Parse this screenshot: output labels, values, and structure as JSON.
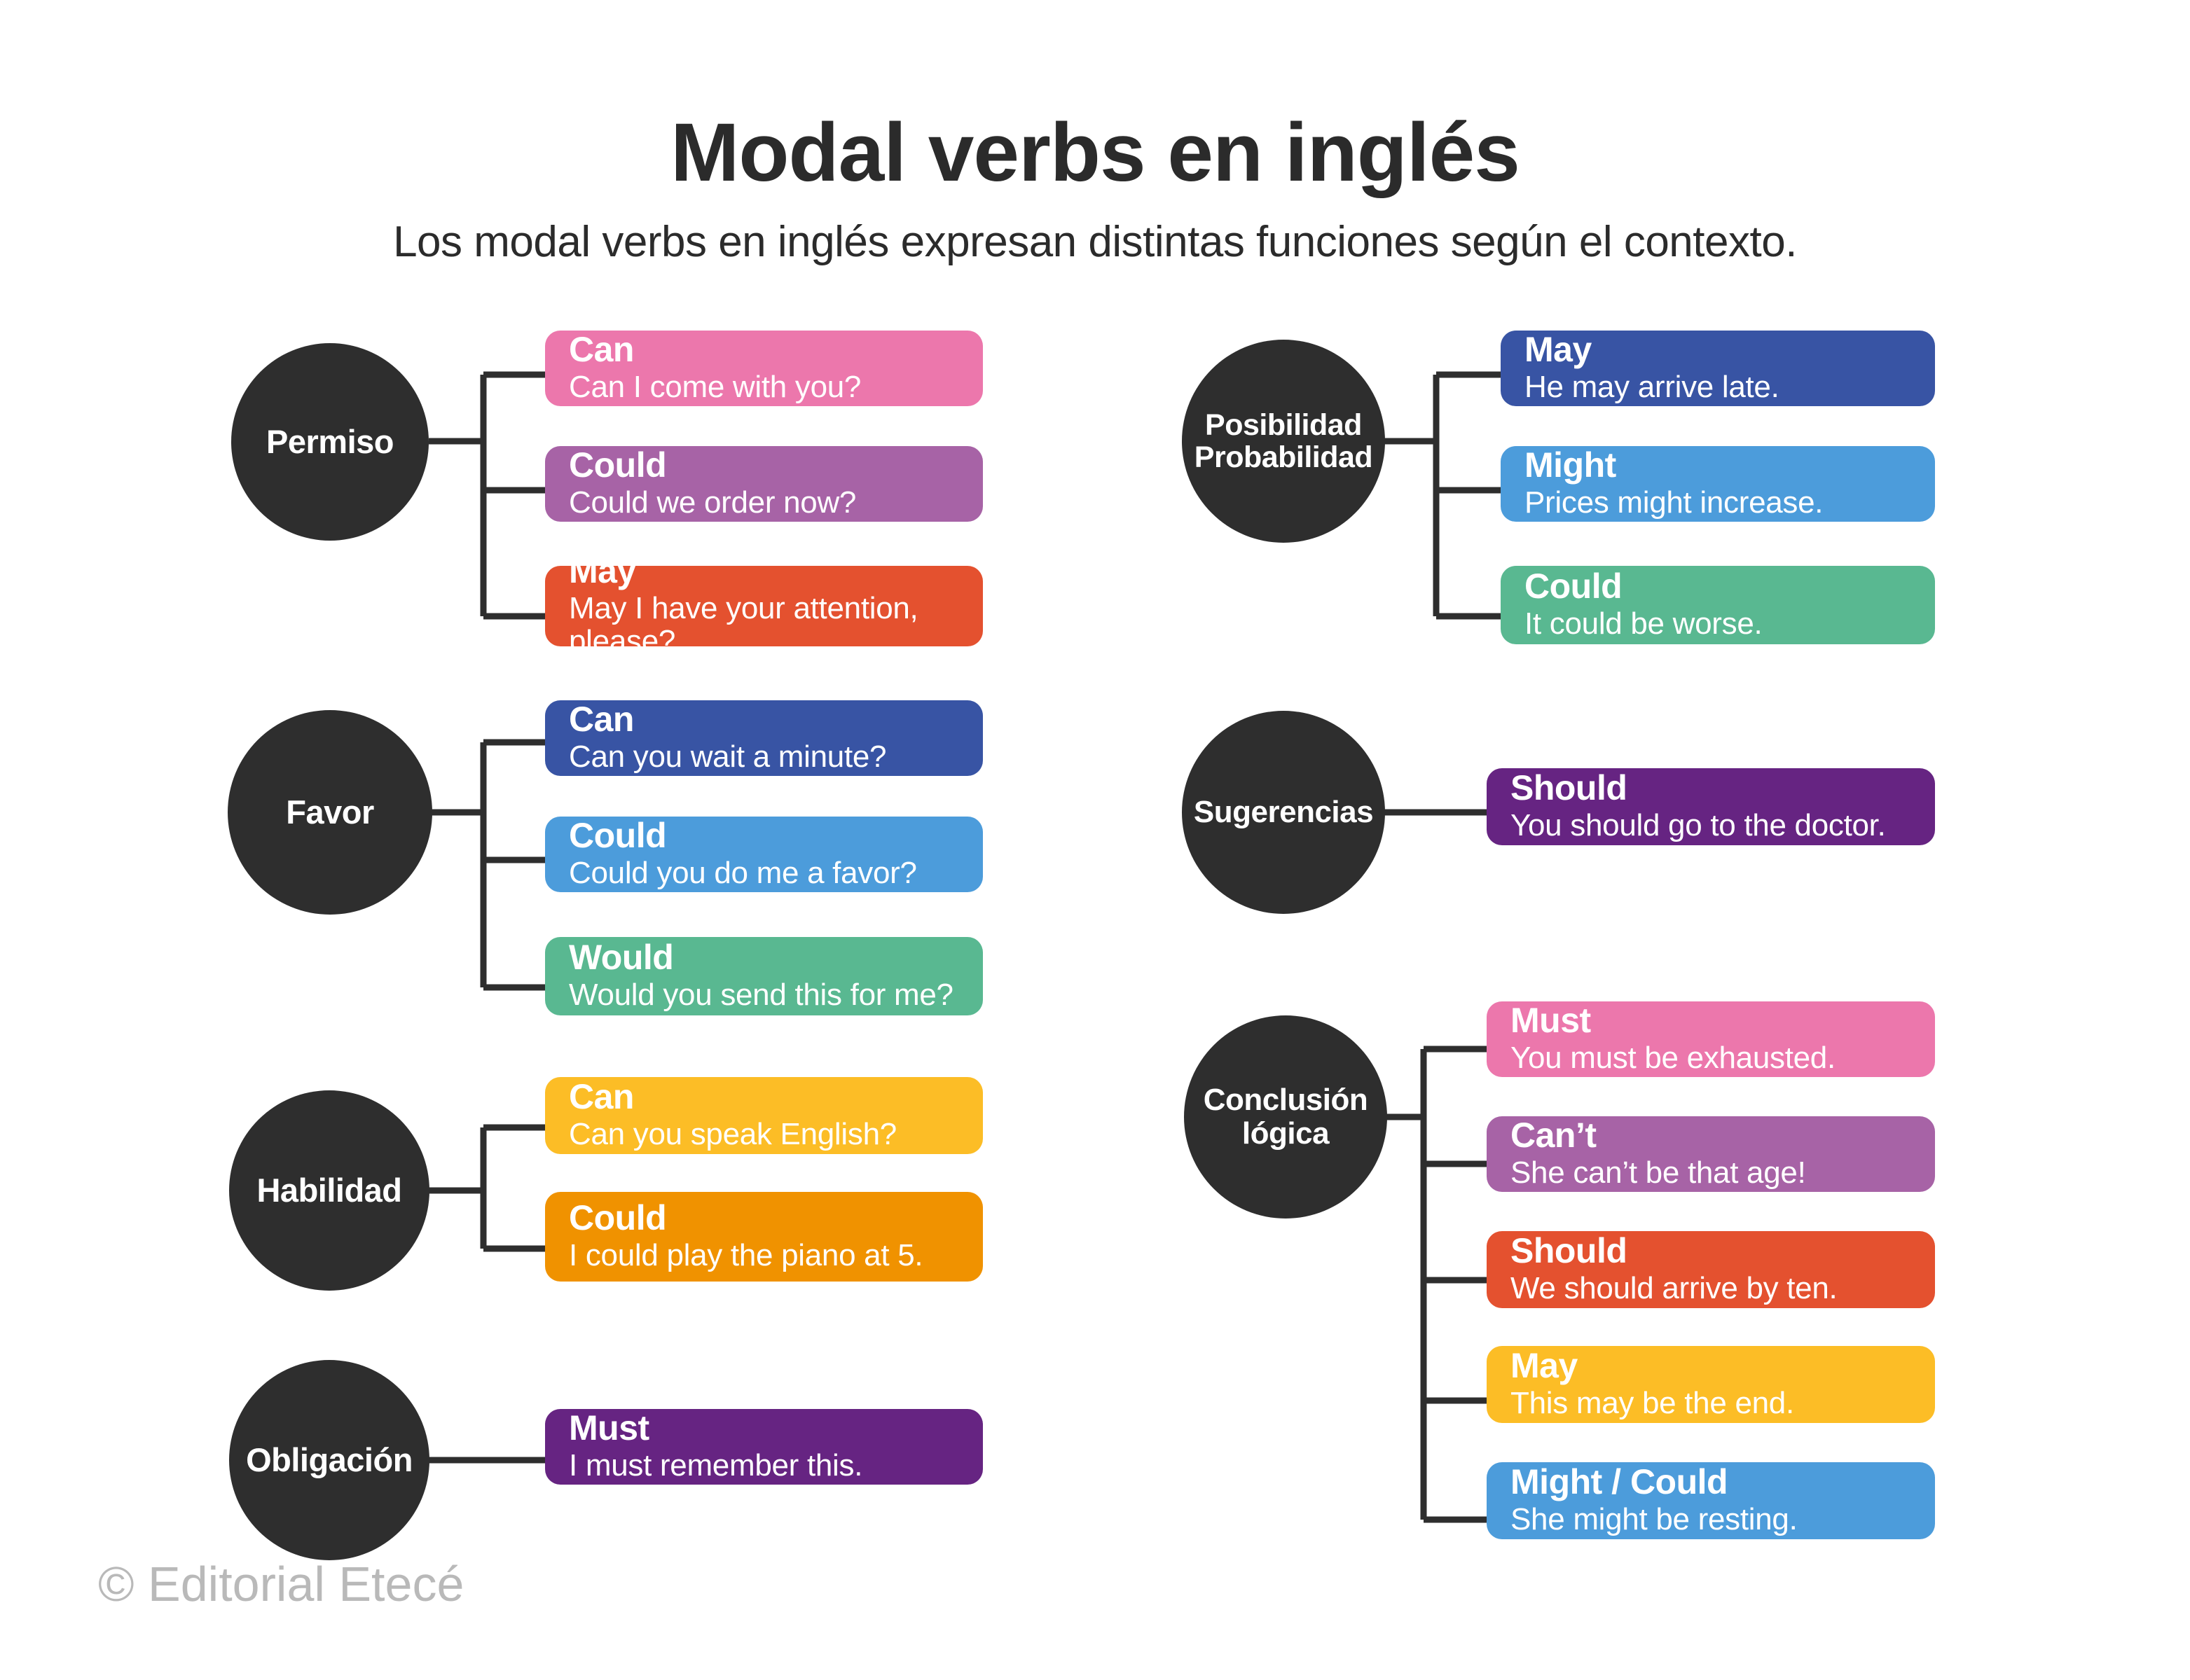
{
  "header": {
    "title": "Modal verbs en inglés",
    "subtitle": "Los modal verbs en inglés expresan distintas funciones según el contexto."
  },
  "watermark": "© Editorial Etecé",
  "colors": {
    "bubble": "#2e2e2e",
    "connector": "#2e2e2e",
    "text_dark": "#2b2b2b",
    "pink": "#ec77ac",
    "mauve": "#a763a6",
    "red": "#e4512f",
    "dark_blue": "#3854a4",
    "light_blue": "#4c9cdb",
    "green": "#59b891",
    "yellow": "#fcbd26",
    "orange": "#f09200",
    "purple": "#662482",
    "watermark": "#b9b9b9"
  },
  "groups": [
    {
      "id": "permiso",
      "label": "Permiso",
      "items": [
        {
          "modal": "Can",
          "example": "Can I come with you?",
          "color": "#ec77ac"
        },
        {
          "modal": "Could",
          "example": "Could we order now?",
          "color": "#a763a6"
        },
        {
          "modal": "May",
          "example": "May I have your attention, please?",
          "color": "#e4512f"
        }
      ]
    },
    {
      "id": "favor",
      "label": "Favor",
      "items": [
        {
          "modal": "Can",
          "example": "Can you wait a minute?",
          "color": "#3854a4"
        },
        {
          "modal": "Could",
          "example": "Could you do me a favor?",
          "color": "#4c9cdb"
        },
        {
          "modal": "Would",
          "example": "Would you send this for me?",
          "color": "#59b891"
        }
      ]
    },
    {
      "id": "habilidad",
      "label": "Habilidad",
      "items": [
        {
          "modal": "Can",
          "example": "Can you speak English?",
          "color": "#fcbd26"
        },
        {
          "modal": "Could",
          "example": "I could play the piano at 5.",
          "color": "#f09200"
        }
      ]
    },
    {
      "id": "obligacion",
      "label": "Obligación",
      "items": [
        {
          "modal": "Must",
          "example": "I must remember this.",
          "color": "#662482"
        }
      ]
    },
    {
      "id": "posibilidad",
      "label": "Posibilidad\nProbabilidad",
      "items": [
        {
          "modal": "May",
          "example": "He may arrive late.",
          "color": "#3854a4"
        },
        {
          "modal": "Might",
          "example": "Prices might increase.",
          "color": "#4c9cdb"
        },
        {
          "modal": "Could",
          "example": "It could be worse.",
          "color": "#59b891"
        }
      ]
    },
    {
      "id": "sugerencias",
      "label": "Sugerencias",
      "items": [
        {
          "modal": "Should",
          "example": "You should go to the doctor.",
          "color": "#662482"
        }
      ]
    },
    {
      "id": "conclusion",
      "label": "Conclusión\nlógica",
      "items": [
        {
          "modal": "Must",
          "example": "You must be exhausted.",
          "color": "#ec77ac"
        },
        {
          "modal": "Can’t",
          "example": "She can’t be that age!",
          "color": "#a763a6"
        },
        {
          "modal": "Should",
          "example": "We should arrive by ten.",
          "color": "#e4512f"
        },
        {
          "modal": "May",
          "example": "This may be the end.",
          "color": "#fcbd26"
        },
        {
          "modal": "Might / Could",
          "example": "She might be resting.",
          "color": "#4c9cdb"
        }
      ]
    }
  ]
}
